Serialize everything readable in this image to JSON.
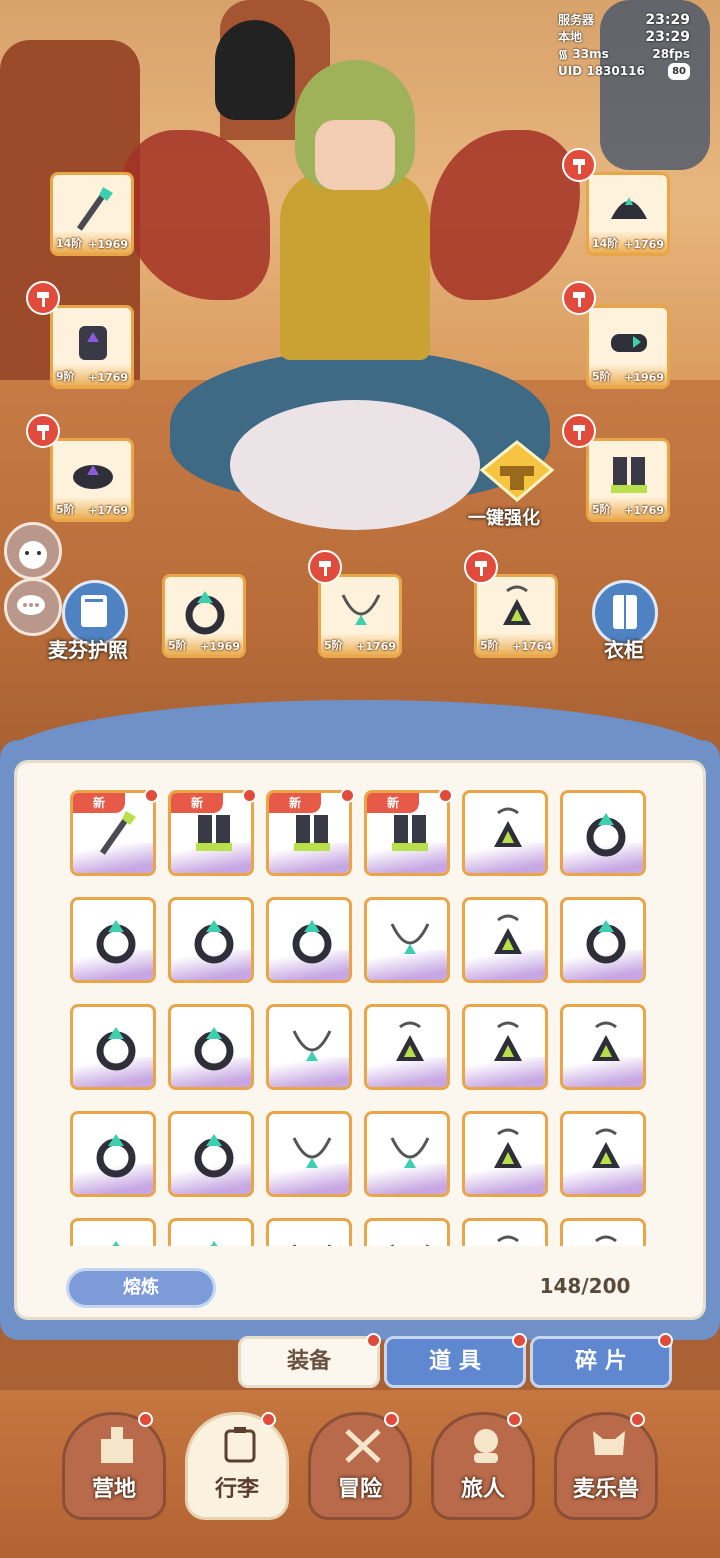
{
  "status": {
    "server_label": "服务器",
    "server_time": "23:29",
    "local_label": "本地",
    "local_time": "23:29",
    "ping": "33ms",
    "fps": "28fps",
    "uid": "UID 1830116",
    "battery": "80"
  },
  "equipment": [
    {
      "name": "weapon",
      "level": "14阶",
      "bonus": "+1969",
      "upgrade": false
    },
    {
      "name": "helmet",
      "level": "14阶",
      "bonus": "+1769",
      "upgrade": true
    },
    {
      "name": "armor",
      "level": "9阶",
      "bonus": "+1769",
      "upgrade": true
    },
    {
      "name": "gloves",
      "level": "5阶",
      "bonus": "+1969",
      "upgrade": true
    },
    {
      "name": "belt",
      "level": "5阶",
      "bonus": "+1769",
      "upgrade": true
    },
    {
      "name": "boots",
      "level": "5阶",
      "bonus": "+1769",
      "upgrade": true
    },
    {
      "name": "ring",
      "level": "5阶",
      "bonus": "+1969",
      "upgrade": false
    },
    {
      "name": "necklace",
      "level": "5阶",
      "bonus": "+1769",
      "upgrade": true
    },
    {
      "name": "amulet",
      "level": "5阶",
      "bonus": "+1764",
      "upgrade": true
    }
  ],
  "buttons": {
    "strengthen": "一键强化",
    "passport": "麦芬护照",
    "wardrobe": "衣柜",
    "smelt": "熔炼"
  },
  "inventory": {
    "count": "148/200",
    "new_label": "新",
    "items": [
      {
        "icon": "staff",
        "new": true
      },
      {
        "icon": "boots",
        "new": true
      },
      {
        "icon": "boots",
        "new": true
      },
      {
        "icon": "boots",
        "new": true
      },
      {
        "icon": "amulet",
        "new": false
      },
      {
        "icon": "ring",
        "new": false
      },
      {
        "icon": "ring",
        "new": false
      },
      {
        "icon": "ring",
        "new": false
      },
      {
        "icon": "ring",
        "new": false
      },
      {
        "icon": "necklace",
        "new": false
      },
      {
        "icon": "amulet",
        "new": false
      },
      {
        "icon": "ring",
        "new": false
      },
      {
        "icon": "ring",
        "new": false
      },
      {
        "icon": "ring",
        "new": false
      },
      {
        "icon": "necklace",
        "new": false
      },
      {
        "icon": "amulet",
        "new": false
      },
      {
        "icon": "amulet",
        "new": false
      },
      {
        "icon": "amulet",
        "new": false
      },
      {
        "icon": "ring",
        "new": false
      },
      {
        "icon": "ring",
        "new": false
      },
      {
        "icon": "necklace",
        "new": false
      },
      {
        "icon": "necklace",
        "new": false
      },
      {
        "icon": "amulet",
        "new": false
      },
      {
        "icon": "amulet",
        "new": false
      },
      {
        "icon": "ring",
        "new": false
      },
      {
        "icon": "ring",
        "new": false
      },
      {
        "icon": "necklace",
        "new": false
      },
      {
        "icon": "necklace",
        "new": false
      },
      {
        "icon": "amulet",
        "new": false
      },
      {
        "icon": "amulet",
        "new": false
      }
    ]
  },
  "tabs": [
    {
      "label": "装备",
      "active": true
    },
    {
      "label": "道 具",
      "active": false
    },
    {
      "label": "碎 片",
      "active": false
    }
  ],
  "nav": [
    {
      "label": "营地",
      "icon": "castle-icon",
      "active": false
    },
    {
      "label": "行李",
      "icon": "backpack-icon",
      "active": true
    },
    {
      "label": "冒险",
      "icon": "crossed-swords-icon",
      "active": false
    },
    {
      "label": "旅人",
      "icon": "character-icon",
      "active": false
    },
    {
      "label": "麦乐兽",
      "icon": "pet-icon",
      "active": false
    }
  ],
  "colors": {
    "accent_blue": "#6f91c8",
    "slot_orange": "#e8a646",
    "notify_red": "#e14b3b"
  }
}
